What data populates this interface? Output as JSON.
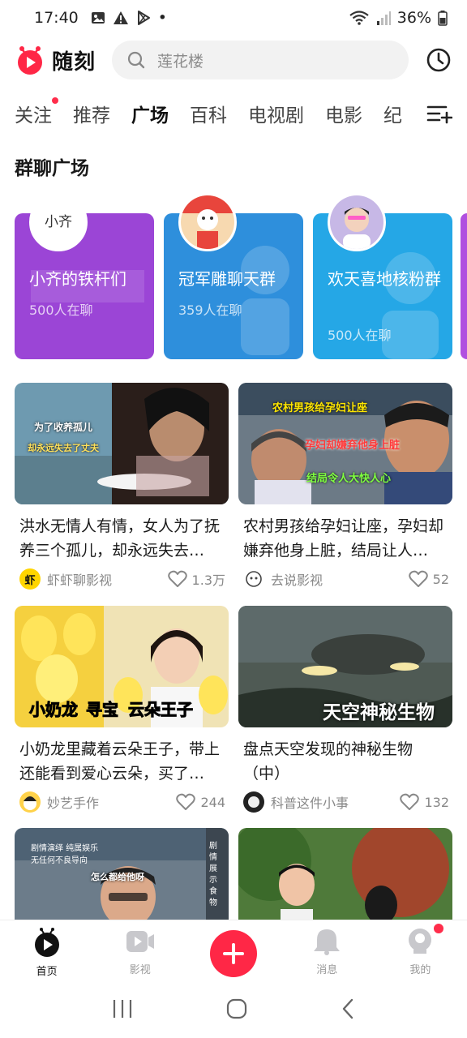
{
  "status_bar": {
    "time": "17:40",
    "battery": "36%",
    "dot": "•"
  },
  "header": {
    "app_name": "随刻",
    "search_placeholder": "莲花楼",
    "icons": [
      "search-icon",
      "history-clock-icon"
    ],
    "brand_color": "#ff2746"
  },
  "tabs": [
    {
      "label": "关注",
      "badge": true
    },
    {
      "label": "推荐"
    },
    {
      "label": "广场",
      "active": true
    },
    {
      "label": "百科"
    },
    {
      "label": "电视剧"
    },
    {
      "label": "电影"
    },
    {
      "label": "纪"
    }
  ],
  "groups_section": {
    "title": "群聊广场",
    "cards": [
      {
        "name": "小齐的铁杆们",
        "count": "500人在聊",
        "color": "#9b45d6",
        "avatar_text": "小齐"
      },
      {
        "name": "冠军雕聊天群",
        "count": "359人在聊",
        "color": "#2e8fdc"
      },
      {
        "name": "欢天喜地核粉群",
        "count": "500人在聊",
        "color": "#25a7e6"
      }
    ]
  },
  "videos": [
    {
      "title": "洪水无情人有情，女人为了抚养三个孤儿，却永远失去…",
      "author": "虾虾聊影视",
      "avatar_text": "虾",
      "likes": "1.3万",
      "captions": [
        "为了收养孤儿",
        "却永远失去了丈夫"
      ]
    },
    {
      "title": "农村男孩给孕妇让座，孕妇却嫌弃他身上脏，结局让人…",
      "author": "去说影视",
      "likes": "52",
      "captions": [
        "农村男孩给孕妇让座",
        "孕妇却嫌弃他身上脏",
        "结局令人大快人心"
      ]
    },
    {
      "title": "小奶龙里藏着云朵王子，带上还能看到爱心云朵，买了…",
      "author": "妙艺手作",
      "likes": "244",
      "captions": [
        "小奶龙",
        "寻宝",
        "云朵王子"
      ]
    },
    {
      "title": "盘点天空发现的神秘生物（中）",
      "author": "科普这件小事",
      "likes": "132",
      "captions": [
        "天空神秘生物"
      ]
    },
    {
      "title": "",
      "author": "",
      "likes": "",
      "captions": [
        "剧情演绎 纯属娱乐",
        "无任何不良导向",
        "怎么都给他呀",
        "剧情展示食物"
      ]
    },
    {
      "title": "",
      "author": "",
      "likes": "",
      "captions": []
    }
  ],
  "bottom_nav": [
    {
      "label": "首页",
      "icon": "home-play-icon",
      "active": true
    },
    {
      "label": "影视",
      "icon": "video-camera-icon"
    },
    {
      "label": "",
      "icon": "plus-icon"
    },
    {
      "label": "消息",
      "icon": "bell-icon"
    },
    {
      "label": "我的",
      "icon": "profile-icon",
      "badge": true
    }
  ]
}
